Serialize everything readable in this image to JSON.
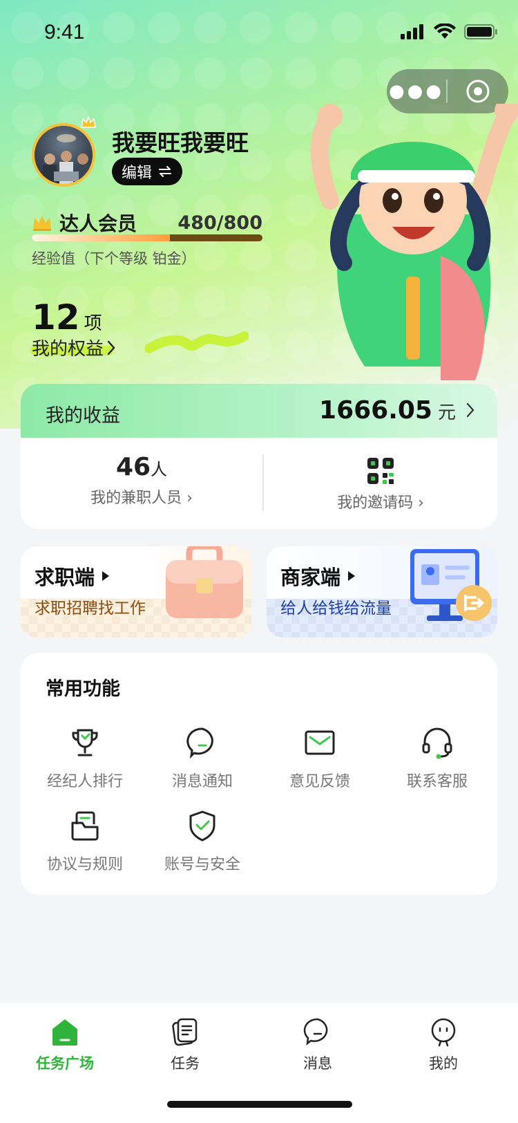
{
  "status_bar": {
    "time": "9:41"
  },
  "profile": {
    "username": "我要旺我要旺",
    "edit_label": "编辑",
    "vip": {
      "title": "达人会员",
      "progress_text": "480/800",
      "progress_fraction": 0.6,
      "exp_note": "经验值（下个等级  铂金）"
    },
    "rights": {
      "count": "12",
      "unit": "项",
      "link_label": "我的权益"
    }
  },
  "earnings": {
    "label": "我的收益",
    "value": "1666.05",
    "unit": "元",
    "staff": {
      "count": "46",
      "unit": "人",
      "label": "我的兼职人员"
    },
    "invite": {
      "label": "我的邀请码"
    }
  },
  "side_cards": [
    {
      "title": "求职端",
      "subtitle": "求职招聘找工作"
    },
    {
      "title": "商家端",
      "subtitle": "给人给钱给流量"
    }
  ],
  "functions": {
    "title": "常用功能",
    "items": [
      {
        "label": "经纪人排行",
        "icon": "trophy-icon"
      },
      {
        "label": "消息通知",
        "icon": "chat-bubble-icon"
      },
      {
        "label": "意见反馈",
        "icon": "mail-icon"
      },
      {
        "label": "联系客服",
        "icon": "headset-icon"
      },
      {
        "label": "协议与规则",
        "icon": "document-icon"
      },
      {
        "label": "账号与安全",
        "icon": "shield-icon"
      }
    ]
  },
  "tabbar": {
    "active_color": "#2fb33a",
    "items": [
      {
        "label": "任务广场",
        "icon": "home-icon",
        "active": true
      },
      {
        "label": "任务",
        "icon": "task-icon",
        "active": false
      },
      {
        "label": "消息",
        "icon": "message-icon",
        "active": false
      },
      {
        "label": "我的",
        "icon": "profile-icon",
        "active": false
      }
    ]
  }
}
